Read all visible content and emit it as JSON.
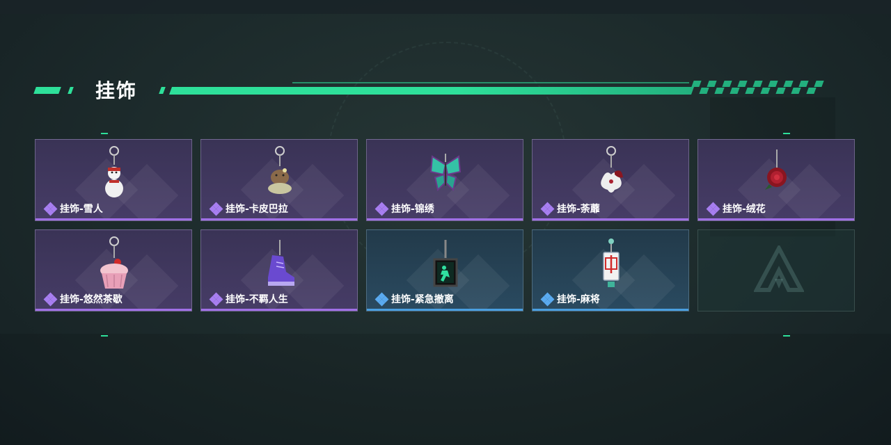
{
  "section": {
    "title": "挂饰"
  },
  "colors": {
    "accent": "#2ee09a",
    "purple_rarity": "#a070e6",
    "blue_rarity": "#4a9fe0"
  },
  "items": [
    {
      "label": "挂饰-雪人",
      "rarity": "purple",
      "icon": "snowman-charm-icon"
    },
    {
      "label": "挂饰-卡皮巴拉",
      "rarity": "purple",
      "icon": "capybara-charm-icon"
    },
    {
      "label": "挂饰-锦绣",
      "rarity": "purple",
      "icon": "butterfly-charm-icon"
    },
    {
      "label": "挂饰-荼蘼",
      "rarity": "purple",
      "icon": "flower-charm-icon"
    },
    {
      "label": "挂饰-绒花",
      "rarity": "purple",
      "icon": "rose-charm-icon"
    },
    {
      "label": "挂饰-悠然茶歇",
      "rarity": "purple",
      "icon": "cupcake-charm-icon"
    },
    {
      "label": "挂饰-不羁人生",
      "rarity": "purple",
      "icon": "sneaker-charm-icon"
    },
    {
      "label": "挂饰-紧急撤离",
      "rarity": "blue",
      "icon": "exit-sign-charm-icon"
    },
    {
      "label": "挂饰-麻将",
      "rarity": "blue",
      "icon": "mahjong-charm-icon"
    },
    {
      "label": "",
      "rarity": "empty",
      "icon": "empty-slot-logo-icon"
    }
  ]
}
